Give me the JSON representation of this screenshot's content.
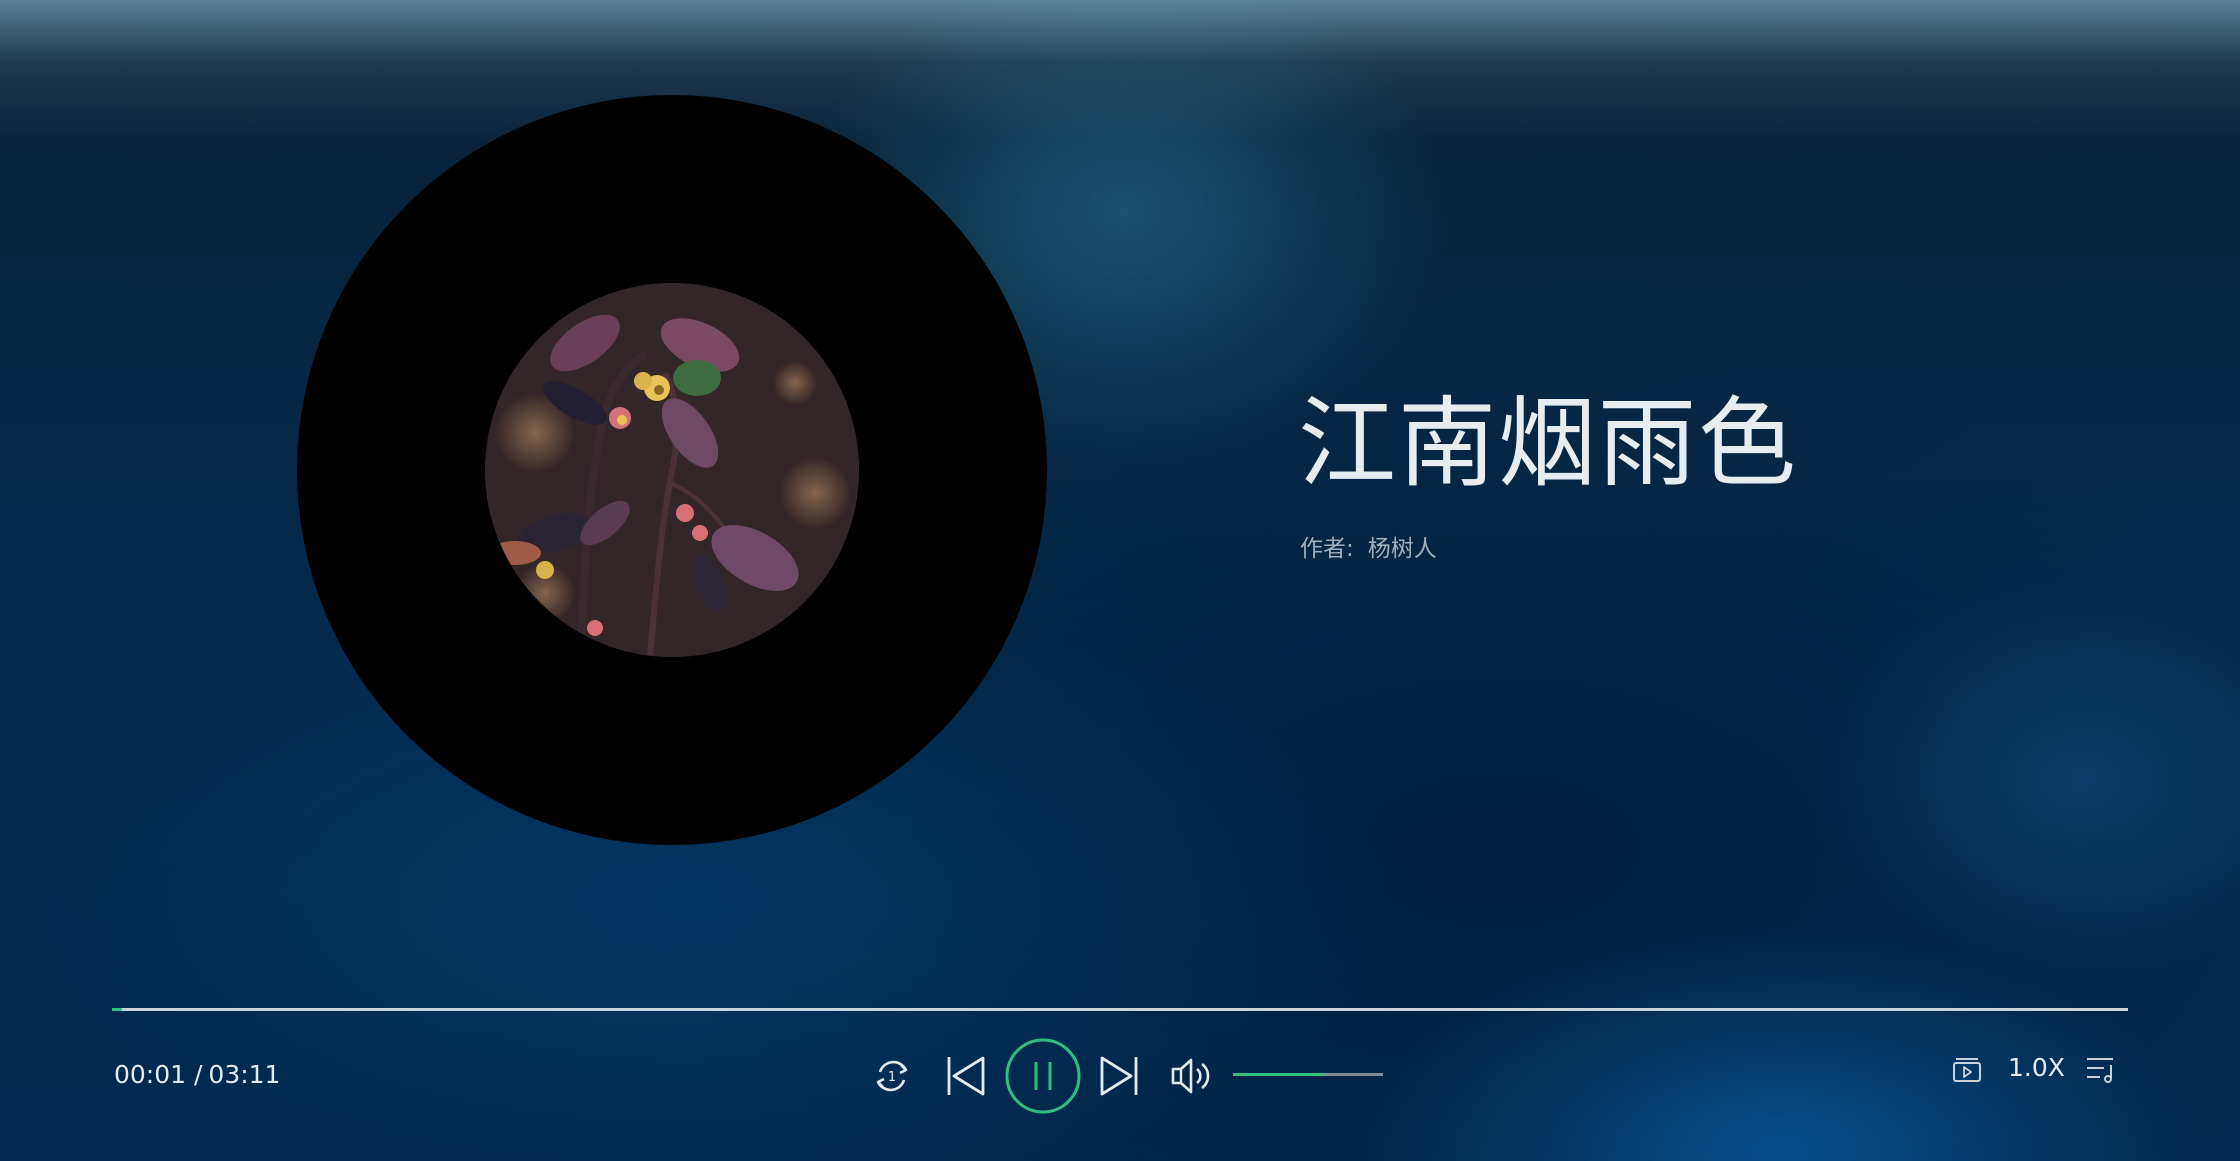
{
  "song": {
    "title": "江南烟雨色",
    "artist_label": "作者:",
    "artist": "杨树人"
  },
  "playback": {
    "current_time": "00:01 /",
    "duration": "03:11",
    "progress_fraction": 0.005,
    "state": "playing",
    "repeat_mode_badge": "1",
    "volume_fraction": 0.6,
    "speed": "1.0X"
  },
  "controls": {
    "repeat_icon": "repeat-one-icon",
    "prev_icon": "skip-previous-icon",
    "play_pause_icon": "pause-icon",
    "next_icon": "skip-next-icon",
    "volume_icon": "volume-icon",
    "mv_icon": "video-icon",
    "playlist_icon": "playlist-icon"
  },
  "colors": {
    "accent": "#2fbf7f",
    "text": "#e3ebef",
    "disc": "#000000"
  }
}
